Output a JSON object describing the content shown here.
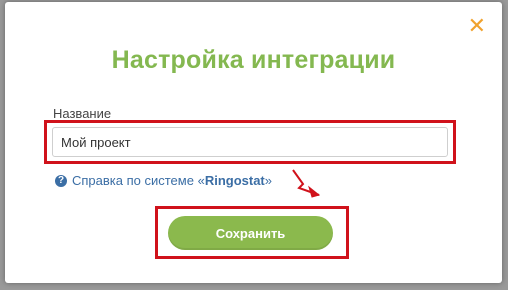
{
  "dialog": {
    "title": "Настройка интеграции",
    "close_icon": "close-icon",
    "field_label": "Название",
    "field_value": "Мой проект",
    "help_prefix": "Справка по системе «",
    "help_system": "Ringostat",
    "help_suffix": "»",
    "help_icon_glyph": "?",
    "save_label": "Сохранить"
  },
  "colors": {
    "title": "#84b850",
    "close": "#f0a22e",
    "link": "#3b6ea5",
    "button": "#8bb94d",
    "annotation": "#d0121b"
  }
}
